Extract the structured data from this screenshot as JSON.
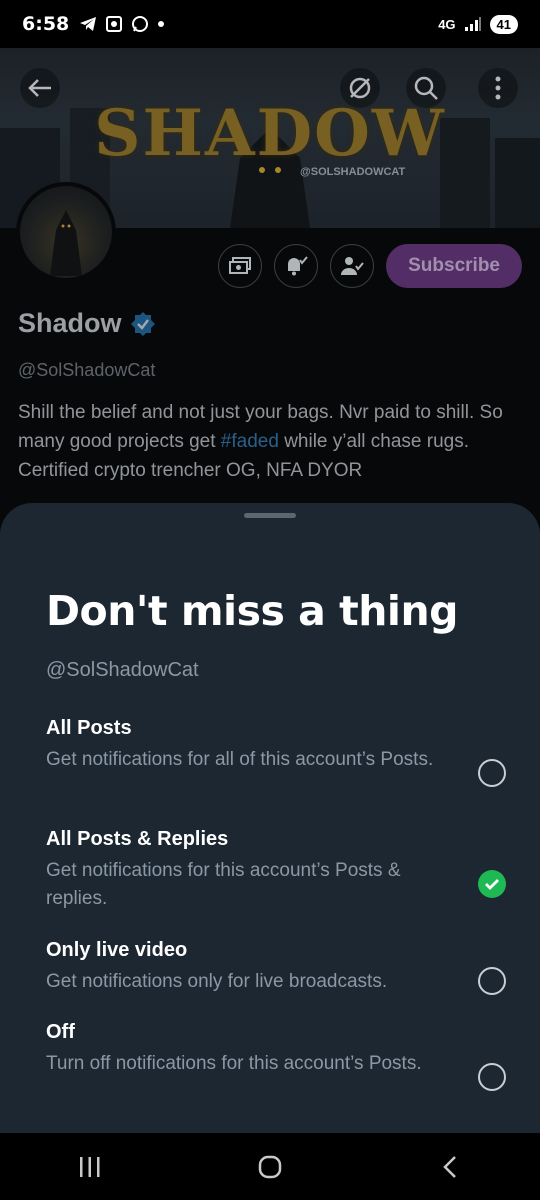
{
  "status": {
    "time": "6:58",
    "network": "4G",
    "battery": "41"
  },
  "profile": {
    "banner_title": "SHADOW",
    "banner_handle": "@SOLSHADOWCAT",
    "name": "Shadow",
    "handle": "@SolShadowCat",
    "bio_part1": "Shill the belief and not just your bags. Nvr paid to shill. So many good projects get ",
    "bio_hashtag": "#faded",
    "bio_part2": " while y’all chase rugs. Certified crypto trencher OG, NFA DYOR",
    "subscribe_label": "Subscribe"
  },
  "sheet": {
    "title": "Don't miss a thing",
    "handle": "@SolShadowCat",
    "options": [
      {
        "title": "All Posts",
        "desc": "Get notifications for all of this account’s Posts.",
        "selected": false
      },
      {
        "title": "All Posts & Replies",
        "desc": "Get notifications for this account’s Posts & replies.",
        "selected": true
      },
      {
        "title": "Only live video",
        "desc": "Get notifications only for live broadcasts.",
        "selected": false
      },
      {
        "title": "Off",
        "desc": "Turn off notifications for this account’s Posts.",
        "selected": false
      }
    ]
  },
  "colors": {
    "accent_green": "#1fb954",
    "subscribe_purple": "#5d2e72",
    "sheet_bg": "#1c2731",
    "verified_blue": "#1d9bf0"
  }
}
